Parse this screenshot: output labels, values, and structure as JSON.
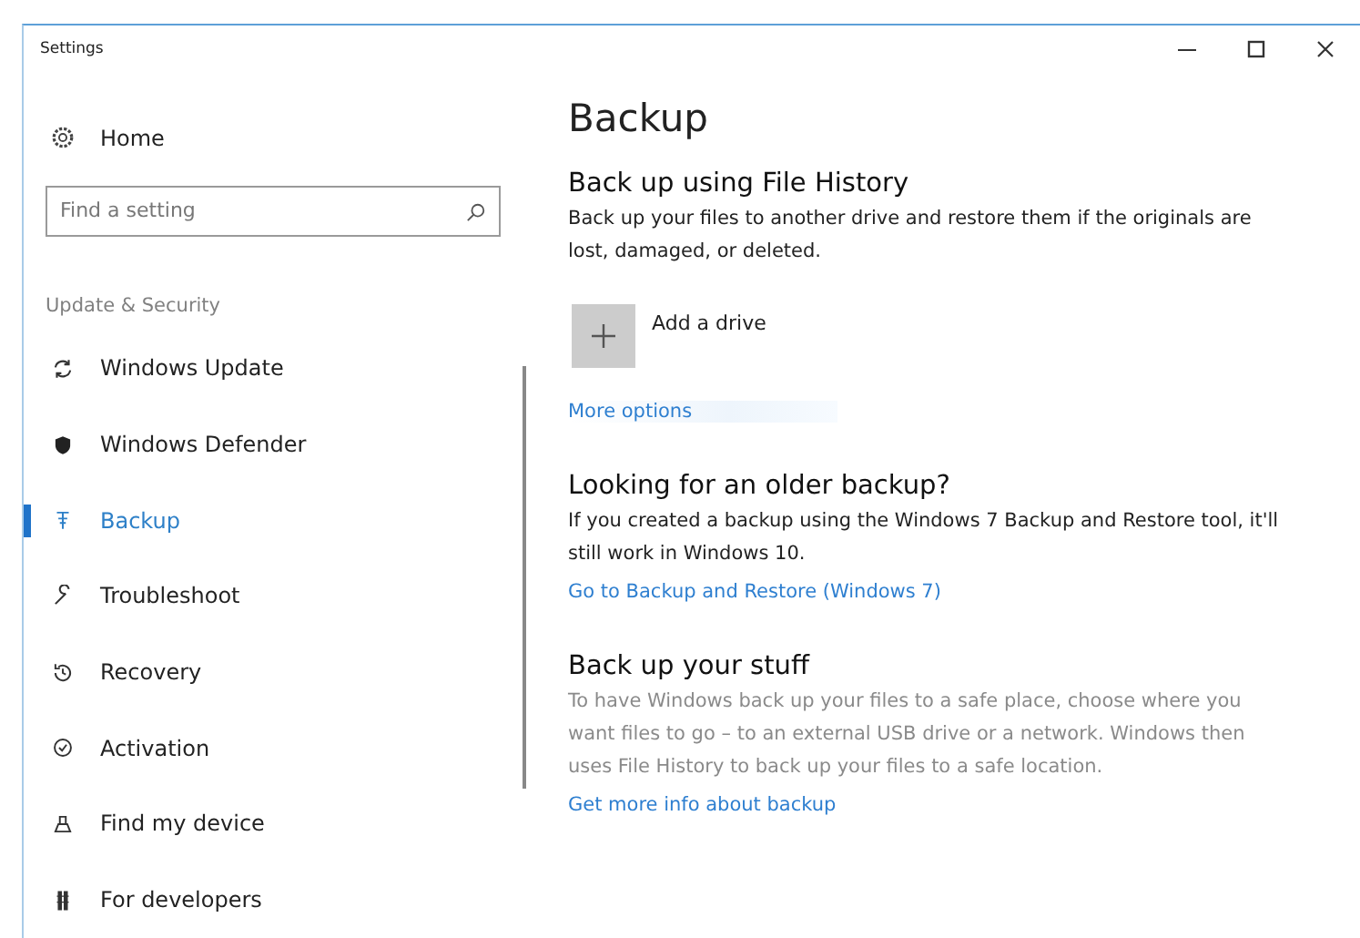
{
  "window": {
    "title": "Settings"
  },
  "sidebar": {
    "home": "Home",
    "search": {
      "placeholder": "Find a setting"
    },
    "section": "Update & Security",
    "items": [
      {
        "label": "Windows Update",
        "selected": false
      },
      {
        "label": "Windows Defender",
        "selected": false
      },
      {
        "label": "Backup",
        "selected": true
      },
      {
        "label": "Troubleshoot",
        "selected": false
      },
      {
        "label": "Recovery",
        "selected": false
      },
      {
        "label": "Activation",
        "selected": false
      },
      {
        "label": "Find my device",
        "selected": false
      },
      {
        "label": "For developers",
        "selected": false
      }
    ]
  },
  "content": {
    "title": "Backup",
    "sections": [
      {
        "heading": "Back up using File History",
        "text": "Back up your files to another drive and restore them if the originals are lost, damaged, or deleted.",
        "add_button": "Add a drive",
        "link": "More options",
        "muted": false
      },
      {
        "heading": "Looking for an older backup?",
        "text": "If you created a backup using the Windows 7 Backup and Restore tool, it'll still work in Windows 10.",
        "link": "Go to Backup and Restore (Windows 7)",
        "muted": false
      },
      {
        "heading": "Back up your stuff",
        "text": "To have Windows back up your files to a safe place, choose where you want files to go – to an external USB drive or a network. Windows then uses File History to back up your files to a safe location.",
        "link": "Get more info about backup",
        "muted": true
      }
    ]
  }
}
